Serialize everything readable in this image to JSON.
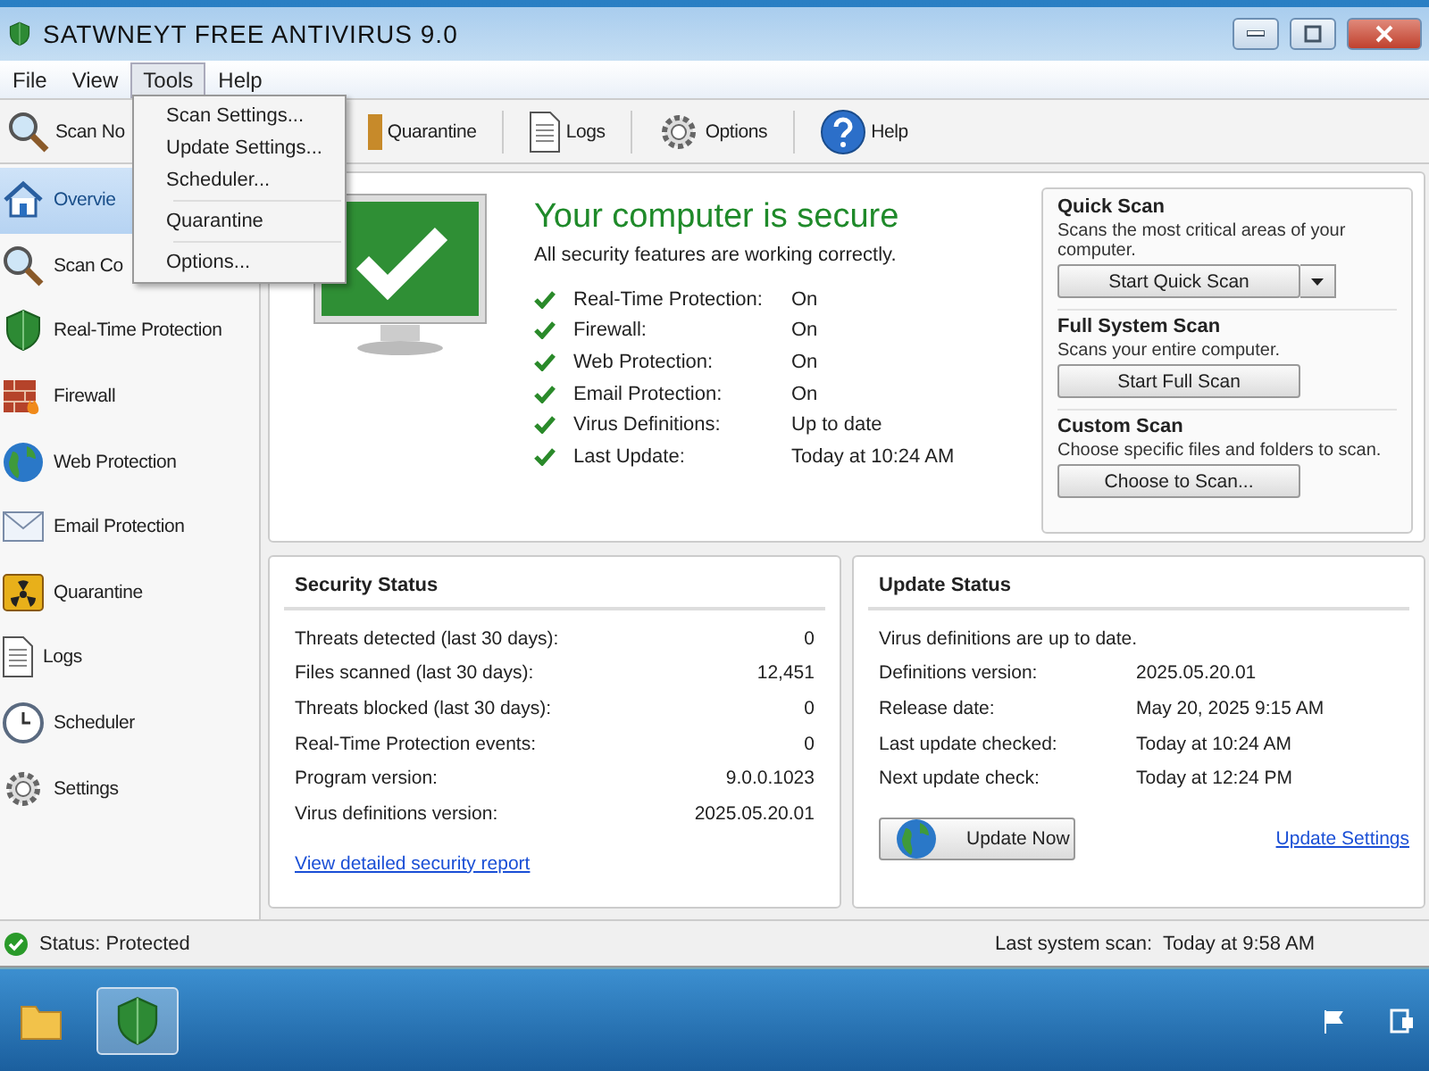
{
  "window": {
    "title": "SATWNEYT FREE ANTIVIRUS 9.0"
  },
  "menu_bar": [
    {
      "label": "File",
      "selected": false
    },
    {
      "label": "View",
      "selected": false
    },
    {
      "label": "Tools",
      "selected": true
    },
    {
      "label": "Help",
      "selected": false
    }
  ],
  "tools_menu": [
    [
      {
        "label": "Scan Settings..."
      },
      {
        "label": "Update Settings..."
      },
      {
        "label": "Scheduler..."
      }
    ],
    [
      {
        "label": "Quarantine"
      }
    ],
    [
      {
        "label": "Options..."
      }
    ]
  ],
  "toolbar": [
    {
      "label": "Scan No"
    },
    {
      "label": "Quarantine"
    },
    {
      "label": "Logs"
    },
    {
      "label": "Options"
    },
    {
      "label": "Help"
    }
  ],
  "sidebar": [
    {
      "label": "Overvie",
      "selected": true
    },
    {
      "label": "Scan Co",
      "selected": false
    },
    {
      "label": "Real-Time Protection",
      "selected": false
    },
    {
      "label": "Firewall",
      "selected": false
    },
    {
      "label": "Web Protection",
      "selected": false
    },
    {
      "label": "Email Protection",
      "selected": false
    },
    {
      "label": "Quarantine",
      "selected": false
    },
    {
      "label": "Logs",
      "selected": false
    },
    {
      "label": "Scheduler",
      "selected": false
    },
    {
      "label": "Settings",
      "selected": false
    }
  ],
  "status": {
    "headline": "Your computer is secure",
    "subtitle": "All security features are working correctly.",
    "items": [
      {
        "label": "Real-Time Protection:",
        "value": "On"
      },
      {
        "label": "Firewall:",
        "value": "On"
      },
      {
        "label": "Web Protection:",
        "value": "On"
      },
      {
        "label": "Email Protection:",
        "value": "On"
      },
      {
        "label": "Virus Definitions:",
        "value": "Up to date"
      },
      {
        "label": "Last Update:",
        "value": "Today at 10:24 AM"
      }
    ]
  },
  "scans": [
    {
      "title": "Quick Scan",
      "description": "Scans the most critical areas of your computer.",
      "button": "Start Quick Scan",
      "dropdown": true
    },
    {
      "title": "Full System Scan",
      "description": "Scans your entire computer.",
      "button": "Start Full Scan",
      "dropdown": false
    },
    {
      "title": "Custom Scan",
      "description": "Choose specific files and folders to scan.",
      "button": "Choose to Scan...",
      "dropdown": false
    }
  ],
  "security_status": {
    "title": "Security Status",
    "rows": [
      {
        "label": "Threats detected (last 30 days):",
        "value": "0"
      },
      {
        "label": "Files scanned (last 30 days):",
        "value": "12,451"
      },
      {
        "label": "Threats blocked (last 30 days):",
        "value": "0"
      },
      {
        "label": "Real-Time Protection events:",
        "value": "0"
      },
      {
        "label": "Program version:",
        "value": "9.0.0.1023"
      },
      {
        "label": "Virus definitions version:",
        "value": "2025.05.20.01"
      }
    ],
    "link": "View detailed security report"
  },
  "update_status": {
    "title": "Update Status",
    "message": "Virus definitions are up to date.",
    "rows": [
      {
        "label": "Definitions version:",
        "value": "2025.05.20.01"
      },
      {
        "label": "Release date:",
        "value": "May 20, 2025 9:15 AM"
      },
      {
        "label": "Last update checked:",
        "value": "Today at 10:24 AM"
      },
      {
        "label": "Next update check:",
        "value": "Today at 12:24 PM"
      }
    ],
    "button": "Update Now",
    "link": "Update Settings"
  },
  "status_bar": {
    "status": "Status: Protected",
    "last_scan": "Last system scan:  Today at 9:58 AM"
  }
}
